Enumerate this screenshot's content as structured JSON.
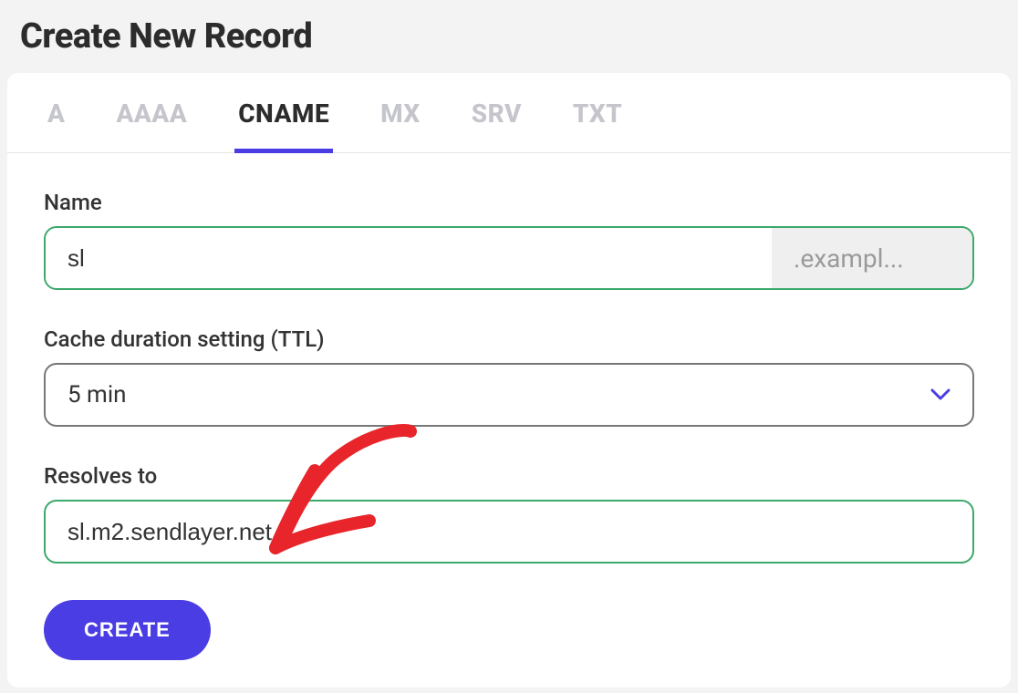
{
  "page": {
    "title": "Create New Record"
  },
  "tabs": [
    {
      "label": "A",
      "active": false
    },
    {
      "label": "AAAA",
      "active": false
    },
    {
      "label": "CNAME",
      "active": true
    },
    {
      "label": "MX",
      "active": false
    },
    {
      "label": "SRV",
      "active": false
    },
    {
      "label": "TXT",
      "active": false
    }
  ],
  "form": {
    "name_label": "Name",
    "name_value": "sl",
    "name_suffix": ".exampl...",
    "ttl_label": "Cache duration setting (TTL)",
    "ttl_value": "5 min",
    "resolves_label": "Resolves to",
    "resolves_value": "sl.m2.sendlayer.net",
    "create_button": "CREATE"
  }
}
